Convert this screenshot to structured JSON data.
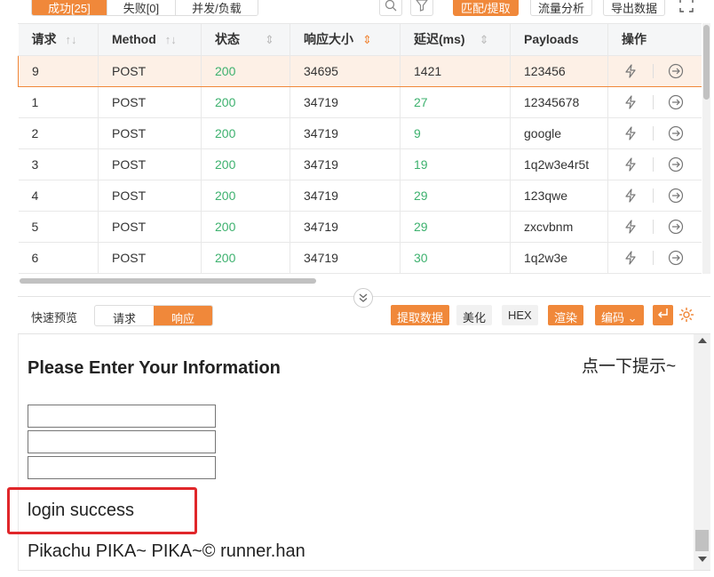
{
  "top_tabs": [
    "成功[25]",
    "失败[0]",
    "并发/负载"
  ],
  "toolbar": {
    "search_icon": "search-icon",
    "filter_icon": "filter-icon",
    "match_extract": "匹配/提取",
    "traffic_analysis": "流量分析",
    "export_data": "导出数据",
    "expand_icon": "expand-icon"
  },
  "columns": [
    "请求",
    "Method",
    "状态",
    "响应大小",
    "延迟(ms)",
    "Payloads",
    "操作"
  ],
  "rows": [
    {
      "id": "9",
      "method": "POST",
      "status": "200",
      "size": "34695",
      "delay": "1421",
      "payload": "123456"
    },
    {
      "id": "1",
      "method": "POST",
      "status": "200",
      "size": "34719",
      "delay": "27",
      "payload": "12345678"
    },
    {
      "id": "2",
      "method": "POST",
      "status": "200",
      "size": "34719",
      "delay": "9",
      "payload": "google"
    },
    {
      "id": "3",
      "method": "POST",
      "status": "200",
      "size": "34719",
      "delay": "19",
      "payload": "1q2w3e4r5t"
    },
    {
      "id": "4",
      "method": "POST",
      "status": "200",
      "size": "34719",
      "delay": "29",
      "payload": "123qwe"
    },
    {
      "id": "5",
      "method": "POST",
      "status": "200",
      "size": "34719",
      "delay": "29",
      "payload": "zxcvbnm"
    },
    {
      "id": "6",
      "method": "POST",
      "status": "200",
      "size": "34719",
      "delay": "30",
      "payload": "1q2w3e"
    }
  ],
  "preview": {
    "label": "快速预览",
    "tabs": [
      "请求",
      "响应"
    ],
    "extract": "提取数据",
    "beautify": "美化",
    "hex": "HEX",
    "render": "渲染",
    "encode": "编码",
    "settings_icon": "gear-icon"
  },
  "render": {
    "title": "Please Enter Your Information",
    "hint": "点一下提示~",
    "success": "login success",
    "footer": "Pikachu PIKA~ PIKA~© runner.han"
  },
  "colors": {
    "accent": "#f0883a",
    "status_green": "#3db16e",
    "highlight": "#e0262a"
  }
}
